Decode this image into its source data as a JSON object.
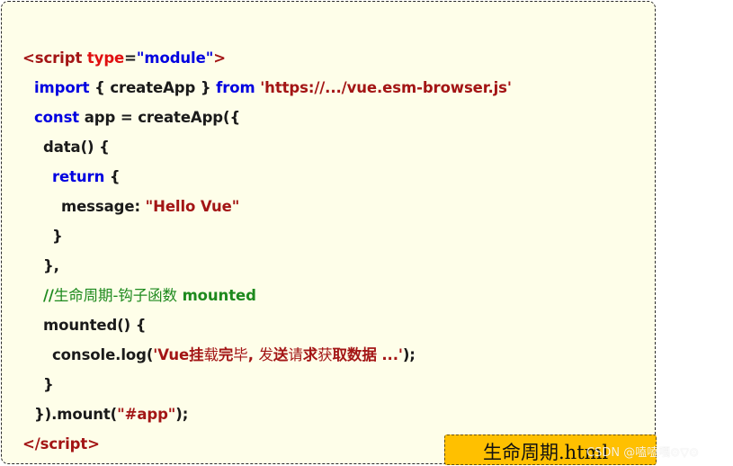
{
  "code": {
    "line1": {
      "open": "<",
      "tag": "script",
      "sp": " ",
      "attr": "type",
      "eq": "=",
      "val": "\"module\"",
      "close": ">"
    },
    "line2": {
      "kw1": "import",
      "mid": " { createApp } ",
      "kw2": "from",
      "sp": " ",
      "str": "'https://.../vue.esm-browser.js'"
    },
    "line3": {
      "kw": "const",
      "rest": " app = createApp({"
    },
    "line4": {
      "text": "data() {"
    },
    "line5": {
      "kw": "return",
      "rest": " {"
    },
    "line6": {
      "key": "message: ",
      "str": "\"Hello Vue\""
    },
    "line7": {
      "text": "}"
    },
    "line8": {
      "text": "},"
    },
    "line9": {
      "slashes": "//",
      "zh": "生命周期-钩子函数",
      "sp": " ",
      "en": "mounted"
    },
    "line10": {
      "text": "mounted() {"
    },
    "line11": {
      "pre": "console.log(",
      "q1": "'",
      "s1": "Vue",
      "s2": "挂",
      "s3": "载",
      "s4": "完",
      "s5": "毕",
      "s6": ", ",
      "s7": "发",
      "s8": "送",
      "s9": "请",
      "s10": "求",
      "s11": "获",
      "s12": "取数据",
      "s13": " ...",
      "q2": "'",
      "post": ");"
    },
    "line12": {
      "text": "}"
    },
    "line13": {
      "pre": "}).mount(",
      "str": "\"#app\"",
      "post": ");"
    },
    "line14": {
      "open": "</",
      "tag": "script",
      "close": ">"
    }
  },
  "file_label": "生命周期.html",
  "watermark": "CSDN @嗑嗑嘎⊙▽⊙"
}
